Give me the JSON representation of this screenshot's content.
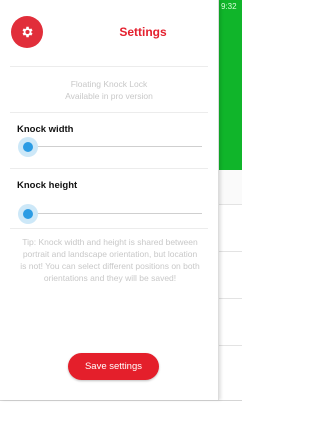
{
  "status_bar": {
    "time": "9:32"
  },
  "header": {
    "title": "Settings",
    "icon": "gear-icon",
    "accent_color": "#e12e3a"
  },
  "pro_note": {
    "line1": "Floating Knock Lock",
    "line2": "Available in pro version"
  },
  "knock_width": {
    "label": "Knock width",
    "value": 0
  },
  "knock_height": {
    "label": "Knock height",
    "value": 0
  },
  "tip": "Tip: Knock width and height is shared between portrait and landscape orientation, but location is not! You can select different positions on both orientations and they will be saved!",
  "save_button": {
    "label": "Save settings",
    "color": "#e41f2b"
  },
  "background_app": {
    "accent_color": "#10b52a"
  }
}
